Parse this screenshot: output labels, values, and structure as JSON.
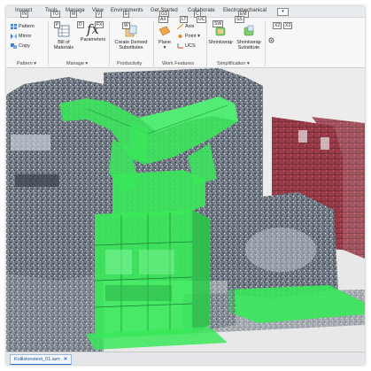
{
  "tabs": [
    "Inspect",
    "Tools",
    "Manage",
    "View",
    "Environments",
    "Get Started",
    "Collaborate",
    "Electromechanical"
  ],
  "keytips": [
    "IN",
    "TO",
    "M",
    "V",
    "E",
    "GS",
    "C",
    "EM",
    "P",
    "D",
    "FX",
    "W",
    "AX",
    "LT",
    "UC",
    "SW",
    "SS",
    "X2",
    "X3"
  ],
  "ribbon": {
    "pattern_group": {
      "pattern": "Pattern",
      "mirror": "Mirror",
      "copy": "Copy",
      "label": "Pattern"
    },
    "manage_group": {
      "bom_line1": "Bill of",
      "bom_line2": "Materials",
      "parameters": "Parameters",
      "fx_glyph": "fx",
      "label": "Manage"
    },
    "productivity_group": {
      "create_line1": "Create Derived",
      "create_line2": "Substitutes",
      "label": "Productivity"
    },
    "work_features_group": {
      "plane": "Plane",
      "axis": "Axis",
      "point": "Point",
      "ucs": "UCS",
      "label": "Work Features"
    },
    "simplification_group": {
      "shrinkwrap": "Shrinkwrap",
      "shrinkwrap_sub_line1": "Shrinkwrap",
      "shrinkwrap_sub_line2": "Substitute",
      "label": "Simplification"
    },
    "dropdown_arrow": "▾"
  },
  "document_tab": {
    "name": "Kollisionstest_01.iam",
    "close": "✕"
  },
  "colors": {
    "accent_blue": "#2b73c8",
    "pipe_green": "#39e85a",
    "brick_red": "#b03b48"
  }
}
